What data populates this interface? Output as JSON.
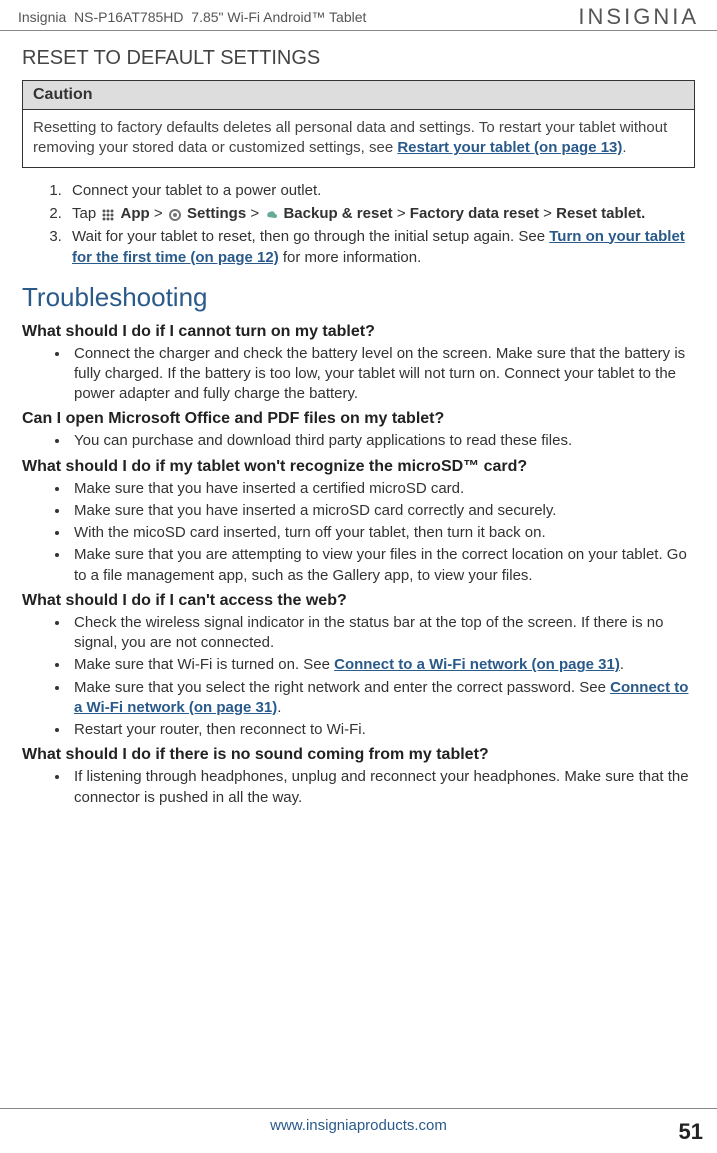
{
  "header": {
    "brand": "Insignia",
    "model": "NS-P16AT785HD",
    "product": "7.85\" Wi-Fi Android™ Tablet",
    "logo": "INSIGNIA"
  },
  "section": {
    "title": "RESET TO DEFAULT SETTINGS",
    "caution": {
      "label": "Caution",
      "text_before_link": "Resetting to factory defaults deletes all personal data and settings. To restart your tablet without removing your stored data or customized settings, see ",
      "link": "Restart your tablet (on page 13)",
      "text_after_link": "."
    },
    "steps": {
      "s1": "Connect your tablet to a power outlet.",
      "s2": {
        "tap": "Tap ",
        "app": "App",
        "gt1": " > ",
        "settings": "Settings",
        "gt2": " > ",
        "backup": "Backup & reset",
        "gt3": " > ",
        "factory": "Factory data reset",
        "gt4": " > ",
        "reset": "Reset tablet."
      },
      "s3": {
        "before": "Wait for your tablet to reset, then go through the initial setup again. See ",
        "link": "Turn on your tablet for the first time (on page 12)",
        "after": " for more information."
      }
    }
  },
  "troubleshooting": {
    "title": "Troubleshooting",
    "q1": {
      "heading": "What should I do if I cannot turn on my tablet?",
      "b1": "Connect the charger and check the battery level on the screen. Make sure that the battery is fully charged. If the battery is too low, your tablet will not turn on. Connect your tablet to the power adapter and fully charge the battery."
    },
    "q2": {
      "heading": "Can I open Microsoft Office and PDF files on my tablet?",
      "b1": "You can purchase and download third party applications to read these files."
    },
    "q3": {
      "heading": "What should I do if my tablet won't recognize the microSD™ card?",
      "b1": "Make sure that you have inserted a certified microSD card.",
      "b2": "Make sure that you have inserted a microSD card correctly and securely.",
      "b3": "With the micoSD card inserted, turn off your tablet, then turn it back on.",
      "b4": "Make sure that you are attempting to view your files in the correct location on your tablet. Go to a file management app, such as the Gallery app, to view your files."
    },
    "q4": {
      "heading": "What should I do if I can't access the web?",
      "b1": "Check the wireless signal indicator in the status bar at the top of the screen. If there is no signal, you are not connected.",
      "b2_before": "Make sure that Wi-Fi is turned on. See ",
      "b2_link": "Connect to a Wi-Fi network (on page 31)",
      "b2_after": ".",
      "b3_before": "Make sure that you select the right network and enter the correct password. See ",
      "b3_link": "Connect to a Wi-Fi network (on page 31)",
      "b3_after": ".",
      "b4": "Restart your router, then reconnect to Wi-Fi."
    },
    "q5": {
      "heading": "What should I do if there is no sound coming from my tablet?",
      "b1": "If listening through headphones, unplug and reconnect your headphones. Make sure that the connector is pushed in all the way."
    }
  },
  "footer": {
    "url": "www.insigniaproducts.com",
    "page": "51"
  }
}
